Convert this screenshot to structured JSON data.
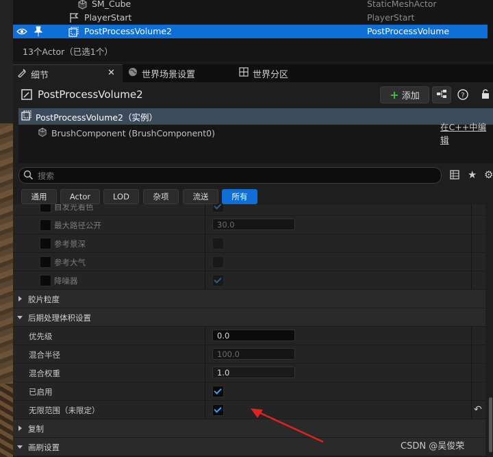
{
  "outliner": {
    "rows": [
      {
        "name": "SM_Cube",
        "type": "StaticMeshActor",
        "icon": "cube-icon",
        "selected": false
      },
      {
        "name": "PlayerStart",
        "type": "PlayerStart",
        "icon": "flag-icon",
        "selected": false
      },
      {
        "name": "PostProcessVolume2",
        "type": "PostProcessVolume",
        "icon": "volume-icon",
        "selected": true
      }
    ],
    "count": "13个Actor（已选1个）"
  },
  "tabs": [
    {
      "label": "细节",
      "icon": "details-icon",
      "active": true
    },
    {
      "label": "世界场景设置",
      "icon": "globe-icon",
      "active": false
    },
    {
      "label": "世界分区",
      "icon": "grid-icon",
      "active": false
    }
  ],
  "details": {
    "title": "PostProcessVolume2",
    "add_label": "添加",
    "components": {
      "root": "PostProcessVolume2（实例）",
      "child": "BrushComponent (BrushComponent0)",
      "edit_link": "在C++中编辑"
    },
    "search_placeholder": "搜索",
    "filters": [
      "通用",
      "Actor",
      "LOD",
      "杂项",
      "流送",
      "所有"
    ],
    "active_filter": "所有"
  },
  "properties": {
    "top_partial": "自发光着色",
    "max_path": {
      "label": "最大路径公开",
      "value": "30.0"
    },
    "ref_dof": "参考景深",
    "ref_atmo": "参考大气",
    "denoiser": "降噪器",
    "film_grain": "胶片粒度",
    "ppv_settings": "后期处理体积设置",
    "priority": {
      "label": "优先级",
      "value": "0.0"
    },
    "blend_radius": {
      "label": "混合半径",
      "value": "100.0"
    },
    "blend_weight": {
      "label": "混合权重",
      "value": "1.0"
    },
    "enabled": "已启用",
    "unbound": "无限范围（未限定）",
    "replication": "复制",
    "brush_settings": "画刷设置"
  },
  "watermark": "CSDN @吴俊荣",
  "accent": "#0f6fd6"
}
